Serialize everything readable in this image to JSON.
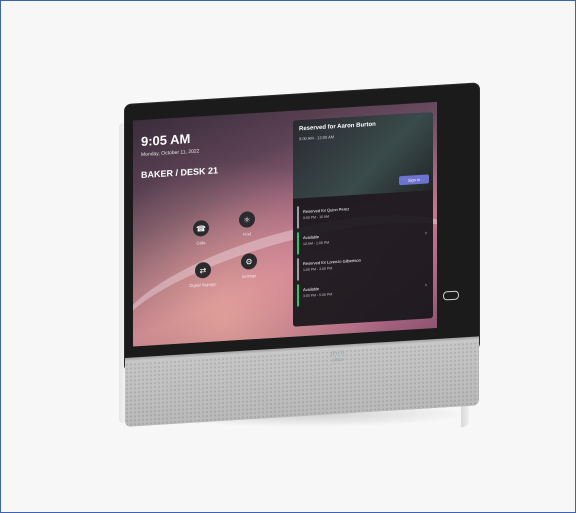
{
  "screen": {
    "time": "9:05 AM",
    "date": "Monday, October 11, 2022",
    "desk": "BAKER / DESK 21",
    "tiles": [
      {
        "label": "Calls",
        "icon": "phone-icon"
      },
      {
        "label": "Find",
        "icon": "bluetooth-icon"
      },
      {
        "label": "Digital Signage",
        "icon": "share-icon"
      },
      {
        "label": "Settings",
        "icon": "gear-icon"
      }
    ]
  },
  "panel": {
    "reserved_title": "Reserved for Aaron Burton",
    "reserved_time": "9:00 AM - 12:00 AM",
    "signin_label": "Sign in",
    "bookings": [
      {
        "title": "Reserved for Quinn Perez",
        "time": "9:00 PM - 10 AM",
        "status": "reserved"
      },
      {
        "title": "Available",
        "time": "10 AM - 1:00 PM",
        "status": "available"
      },
      {
        "title": "Reserved for Lorenzo Gilbertson",
        "time": "1:00 PM - 3:00 PM",
        "status": "reserved"
      },
      {
        "title": "Available",
        "time": "3:00 PM - 5:00 PM",
        "status": "available"
      }
    ]
  },
  "brand": {
    "logo_text": "cisco"
  },
  "colors": {
    "accent": "#6e73cf",
    "available": "#32c26b",
    "frame_border": "#3a64b0"
  }
}
